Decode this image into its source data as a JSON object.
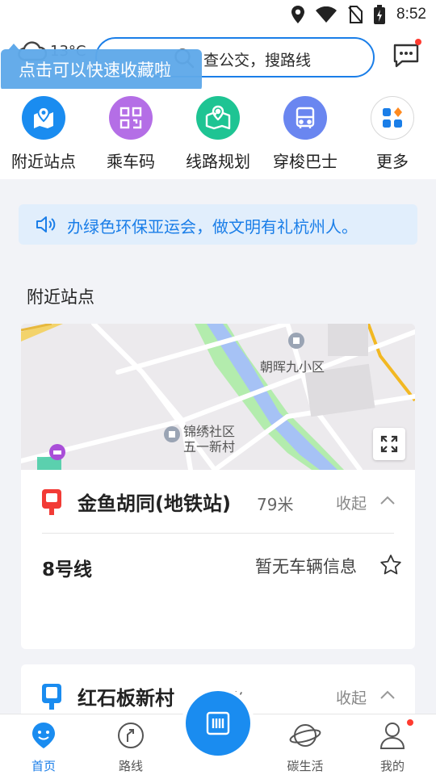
{
  "status": {
    "time": "8:52"
  },
  "header": {
    "temperature": "13°C",
    "search_placeholder": "查公交，搜路线",
    "tooltip": "点击可以快速收藏啦"
  },
  "quick": [
    {
      "label": "附近站点",
      "icon": "location-map-icon",
      "color": "#1a8cf0"
    },
    {
      "label": "乘车码",
      "icon": "qr-code-icon",
      "color": "#b46ee6"
    },
    {
      "label": "线路规划",
      "icon": "route-map-icon",
      "color": "#1ec493"
    },
    {
      "label": "穿梭巴士",
      "icon": "bus-icon",
      "color": "#6a86f0"
    },
    {
      "label": "更多",
      "icon": "more-grid-icon",
      "color": "#ffffff"
    }
  ],
  "notice": "办绿色环保亚运会，做文明有礼杭州人。",
  "nearby": {
    "title": "附近站点",
    "map_labels": [
      "朝晖九小区",
      "锦绣社区",
      "五一新村"
    ],
    "stops": [
      {
        "name": "金鱼胡同(地铁站)",
        "distance": "79米",
        "collapse": "收起",
        "route": "8号线",
        "route_status": "暂无车辆信息"
      },
      {
        "name": "红石板新村",
        "distance": "199米",
        "collapse": "收起"
      }
    ]
  },
  "tabs": [
    {
      "label": "首页",
      "active": true
    },
    {
      "label": "路线",
      "active": false
    },
    {
      "label": "碳生活",
      "active": false
    },
    {
      "label": "我的",
      "active": false
    }
  ],
  "colors": {
    "accent": "#1a7ee8",
    "notice_bg": "#e1eefc",
    "badge": "#ff3b30"
  }
}
